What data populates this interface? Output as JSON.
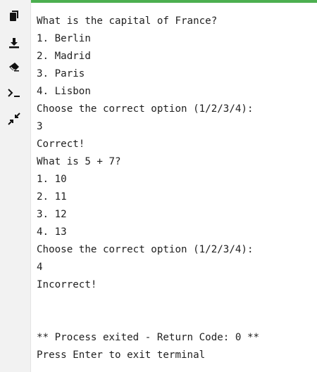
{
  "sidebar": {
    "tools": [
      {
        "icon": "copy-icon"
      },
      {
        "icon": "download-icon"
      },
      {
        "icon": "eraser-icon"
      },
      {
        "icon": "terminal-prompt-icon"
      },
      {
        "icon": "collapse-icon"
      }
    ]
  },
  "colors": {
    "accent": "#4caf50",
    "sidebar_bg": "#f2f2f2",
    "text": "#1f1f1f",
    "icon": "#111111"
  },
  "terminal": {
    "lines": [
      "What is the capital of France?",
      "1. Berlin",
      "2. Madrid",
      "3. Paris",
      "4. Lisbon",
      "Choose the correct option (1/2/3/4):",
      "3",
      "Correct!",
      "What is 5 + 7?",
      "1. 10",
      "2. 11",
      "3. 12",
      "4. 13",
      "Choose the correct option (1/2/3/4):",
      "4",
      "Incorrect!",
      "",
      "",
      "** Process exited - Return Code: 0 **",
      "Press Enter to exit terminal"
    ]
  }
}
